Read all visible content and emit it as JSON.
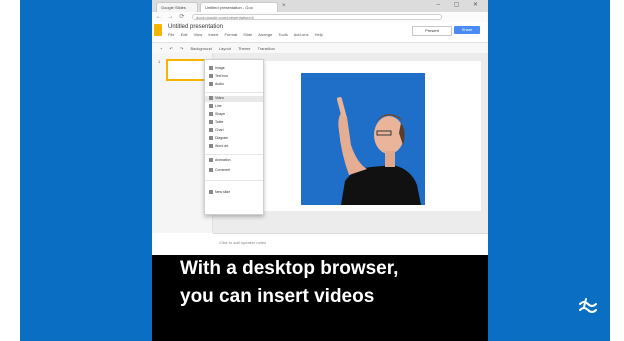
{
  "browser": {
    "tabs": [
      {
        "label": "Google Slides"
      },
      {
        "label": "Untitled presentation - Goo"
      }
    ],
    "tab_close": "×",
    "window_controls": "– ▢ ✕",
    "nav": "← → ⟳",
    "url": "docs.google.com/presentation/d/"
  },
  "app": {
    "doc_title": "Untitled presentation",
    "menus": [
      "File",
      "Edit",
      "View",
      "Insert",
      "Format",
      "Slide",
      "Arrange",
      "Tools",
      "Add-ons",
      "Help"
    ],
    "present_label": "Present",
    "share_label": "Share",
    "toolbar_items": [
      "+",
      "↶",
      "↷",
      "Background",
      "Layout",
      "Theme",
      "Transition"
    ],
    "thumbnail_number": "1",
    "notes_placeholder": "Click to add speaker notes"
  },
  "insert_menu": {
    "items": [
      {
        "label": "Image"
      },
      {
        "label": "Text box"
      },
      {
        "label": "Audio"
      },
      {
        "label": "Video"
      },
      {
        "label": "Line"
      },
      {
        "label": "Shape"
      },
      {
        "label": "Table"
      },
      {
        "label": "Chart"
      },
      {
        "label": "Diagram"
      },
      {
        "label": "Word art"
      },
      {
        "label": "Animation"
      },
      {
        "label": "Comment"
      },
      {
        "label": "New slide"
      }
    ],
    "highlighted": "Video"
  },
  "caption": {
    "line1": "With a desktop browser,",
    "line2": "you can insert videos"
  },
  "colors": {
    "frame_blue": "#0a6fc2",
    "caption_bg": "#000000",
    "caption_text": "#ffffff",
    "share_blue": "#4a8af4",
    "slides_yellow": "#f4b400"
  }
}
